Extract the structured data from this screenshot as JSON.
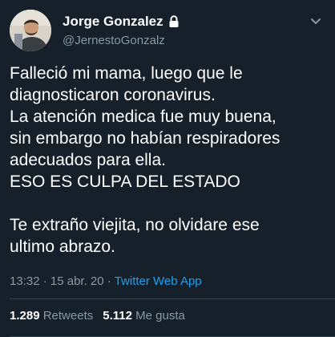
{
  "author": {
    "display_name": "Jorge Gonzalez",
    "handle": "@JernestoGonzalz",
    "protected": true
  },
  "tweet": {
    "text": "Falleció mi mama, luego que le\ndiagnosticaron coronavirus.\nLa atención medica fue muy buena,\nsin embargo no habían respiradores\nadecuados para ella.\nESO ES CULPA DEL ESTADO\n\nTe extraño viejita, no olvidare ese\nultimo abrazo.",
    "time": "13:32",
    "date": "15 abr. 20",
    "source": "Twitter Web App"
  },
  "stats": {
    "retweets_count": "1.289",
    "retweets_label": "Retweets",
    "likes_count": "5.112",
    "likes_label": "Me gusta"
  },
  "icons": {
    "lock": "lock-icon",
    "more": "chevron-down-icon"
  },
  "colors": {
    "background": "#15202b",
    "text": "#ffffff",
    "secondary": "#8899a6",
    "link": "#1da1f2",
    "divider": "#38444d"
  }
}
